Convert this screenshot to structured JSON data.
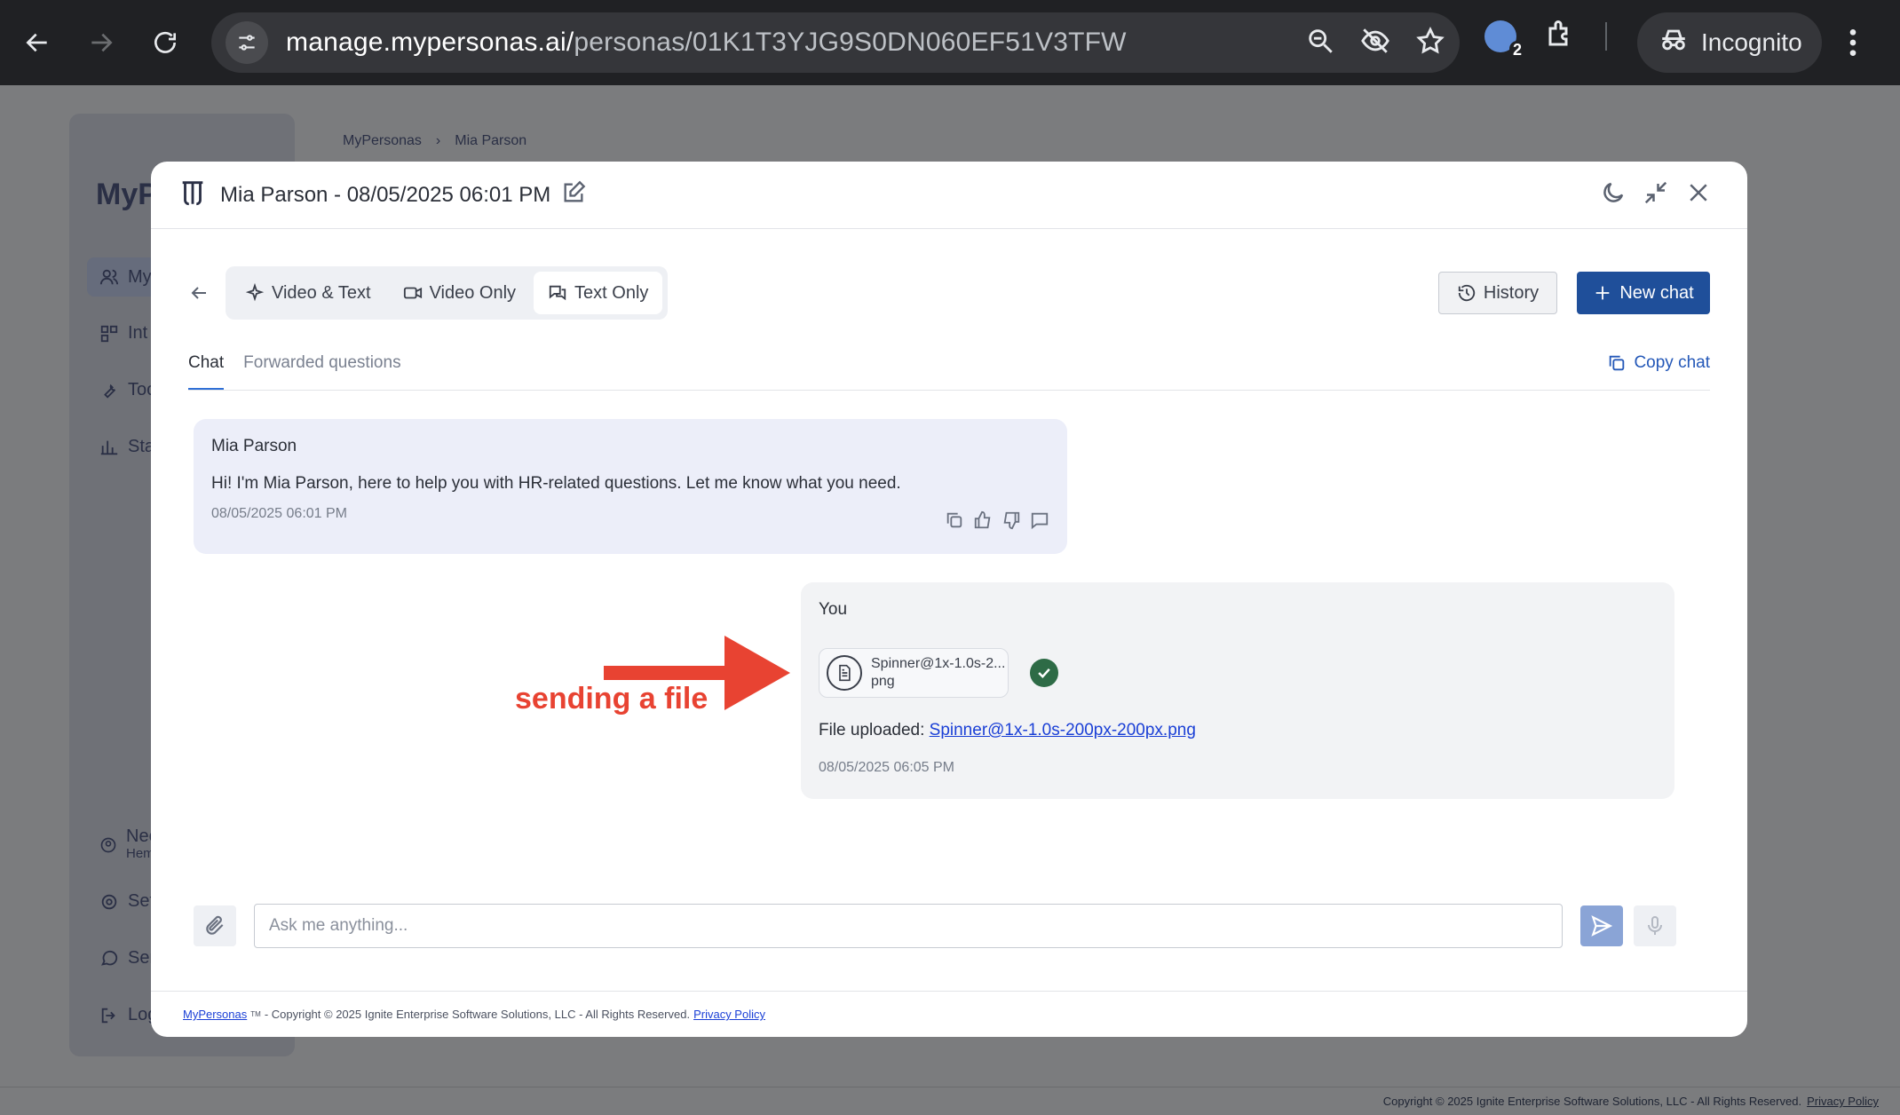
{
  "browser": {
    "url_domain": "manage.mypersonas.ai/",
    "url_path": "personas/01K1T3YJG9S0DN060EF51V3TFW",
    "incognito_label": "Incognito",
    "extension_badge": "2"
  },
  "background": {
    "logo_text": "MyP",
    "sidebar_items": [
      "My",
      "Int",
      "Too",
      "Sta"
    ],
    "sidebar_bottom": [
      "Nee",
      "Hem",
      "Set",
      "Sen",
      "Log"
    ],
    "breadcrumb": [
      "MyPersonas",
      "Mia Parson"
    ],
    "footer_text": "Copyright © 2025 Ignite Enterprise Software Solutions, LLC - All Rights Reserved.",
    "footer_link": "Privacy Policy"
  },
  "modal": {
    "title": "Mia Parson - 08/05/2025 06:01 PM",
    "modes": [
      "Video & Text",
      "Video Only",
      "Text Only"
    ],
    "history_label": "History",
    "new_chat_label": "New chat",
    "tabs": [
      "Chat",
      "Forwarded questions"
    ],
    "copy_chat_label": "Copy chat",
    "bot_message": {
      "sender": "Mia Parson",
      "text": "Hi! I'm Mia Parson, here to help you with HR-related questions. Let me know what you need.",
      "time": "08/05/2025 06:01 PM"
    },
    "user_message": {
      "sender": "You",
      "file_name": "Spinner@1x-1.0s-2...",
      "file_ext": "png",
      "uploaded_prefix": "File uploaded:",
      "uploaded_link": "Spinner@1x-1.0s-200px-200px.png",
      "time": "08/05/2025 06:05 PM"
    },
    "annotation": "sending a file",
    "composer_placeholder": "Ask me anything...",
    "footer": {
      "brand": "MyPersonas",
      "tm": "TM",
      "text": " - Copyright © 2025 Ignite Enterprise Software Solutions, LLC - All Rights Reserved.",
      "privacy": "Privacy Policy"
    }
  },
  "colors": {
    "accent": "#1f4f9a",
    "annotation": "#e84332",
    "success": "#2e6b46"
  }
}
